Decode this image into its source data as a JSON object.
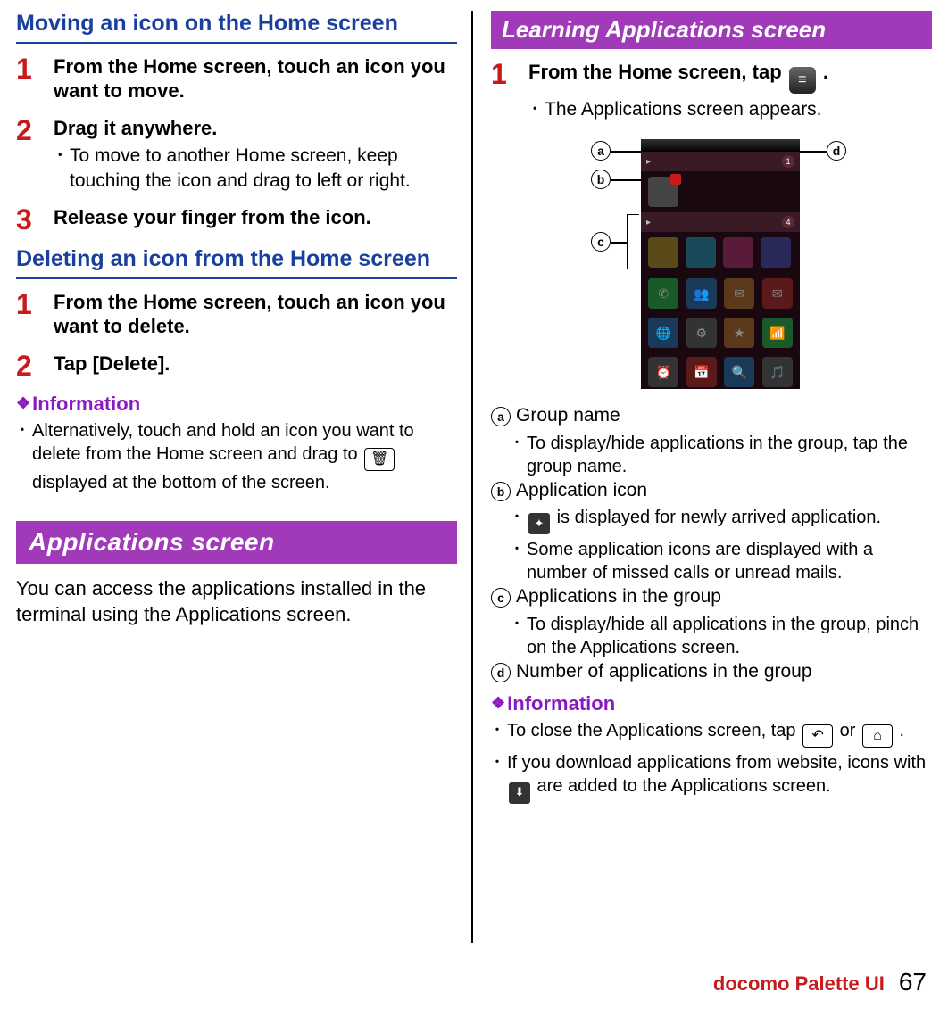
{
  "left": {
    "heading_move": "Moving an icon on the Home screen",
    "move_steps": [
      {
        "num": "1",
        "bold": "From the Home screen, touch an icon you want to move."
      },
      {
        "num": "2",
        "bold": "Drag it anywhere.",
        "bullets": [
          "To move to another Home screen, keep touching the icon and drag to left or right."
        ]
      },
      {
        "num": "3",
        "bold": "Release your finger from the icon."
      }
    ],
    "heading_delete": "Deleting an icon from the Home screen",
    "delete_steps": [
      {
        "num": "1",
        "bold": "From the Home screen, touch an icon you want to delete."
      },
      {
        "num": "2",
        "bold": "Tap [Delete]."
      }
    ],
    "info_label": "Information",
    "info_before": "Alternatively, touch and hold an icon you want to delete from the Home screen and drag to ",
    "info_after": " displayed at the bottom of the screen.",
    "apps_banner": "Applications screen",
    "apps_para": "You can access the applications installed in the terminal using the Applications screen."
  },
  "right": {
    "banner": "Learning Applications screen",
    "step1": {
      "num": "1",
      "bold_before": "From the Home screen, tap ",
      "bold_after": " .",
      "bullet": "The Applications screen appears."
    },
    "callouts": {
      "a": "a",
      "b": "b",
      "c": "c",
      "d": "d"
    },
    "legend": [
      {
        "n": "a",
        "label": "Group name",
        "bullets": [
          "To display/hide applications in the group, tap the group name."
        ]
      },
      {
        "n": "b",
        "label": "Application icon",
        "bullets": [
          "is displayed for newly arrived application.",
          "Some application icons are displayed with a number of missed calls or unread mails."
        ]
      },
      {
        "n": "c",
        "label": "Applications in the group",
        "bullets": [
          "To display/hide all applications in the group, pinch on the Applications screen."
        ]
      },
      {
        "n": "d",
        "label": "Number of applications in the group"
      }
    ],
    "info_label": "Information",
    "info_bullets": {
      "close_before": "To close the Applications screen, tap ",
      "close_mid": " or ",
      "close_after": " .",
      "dl_before": "If you download applications from website, icons with ",
      "dl_after": " are added to the Applications screen."
    }
  },
  "footer": {
    "label": "docomo Palette UI",
    "page": "67"
  }
}
